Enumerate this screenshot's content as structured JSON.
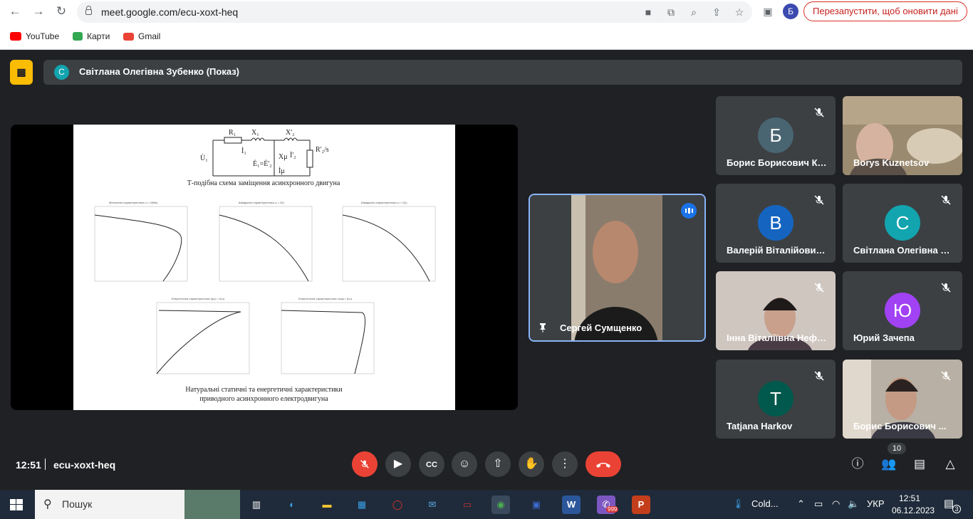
{
  "browser": {
    "url": "meet.google.com/ecu-xoxt-heq",
    "profile_initial": "Б",
    "relaunch_label": "Перезапустити, щоб оновити дані",
    "bookmarks": [
      {
        "label": "YouTube",
        "color": "#ff0000"
      },
      {
        "label": "Карти",
        "color": "#34a853"
      },
      {
        "label": "Gmail",
        "color": "#ea4335"
      }
    ]
  },
  "meet": {
    "presenter": {
      "initial": "С",
      "label": "Світлана Олегівна Зубенко (Показ)"
    },
    "slide": {
      "diagram_caption": "Т-подібна схема заміщення асинхронного двигуна",
      "bottom_caption_line1": "Натуральні статичні та енергетичні характеристики",
      "bottom_caption_line2": "приводного асинхронного електродвигуна"
    },
    "featured": {
      "name": "Сергей Сумщенко"
    },
    "participants": [
      {
        "initial": "Б",
        "name": "Борис Борисович Ко...",
        "color": "#4a6572",
        "photo": false
      },
      {
        "initial": "",
        "name": "Borys Kuznetsov",
        "color": "",
        "photo": true
      },
      {
        "initial": "В",
        "name": "Валерій Віталійович ...",
        "color": "#1565c0",
        "photo": false
      },
      {
        "initial": "С",
        "name": "Світлана Олегівна З...",
        "color": "#12a4af",
        "photo": false
      },
      {
        "initial": "",
        "name": "Інна Віталіївна Нефь...",
        "color": "",
        "photo": true
      },
      {
        "initial": "Ю",
        "name": "Юрий Зачепа",
        "color": "#a142f4",
        "photo": false
      },
      {
        "initial": "T",
        "name": "Tatjana Harkov",
        "color": "#00594c",
        "photo": false
      },
      {
        "initial": "",
        "name": "Борис Борисович ...",
        "color": "",
        "photo": true
      }
    ],
    "time": "12:51",
    "meeting_code": "ecu-xoxt-heq",
    "participant_count": "10"
  },
  "taskbar": {
    "search_placeholder": "Пошук",
    "weather": "Cold...",
    "language": "УКР",
    "time": "12:51",
    "date": "06.12.2023",
    "notifications": "3",
    "viber_badge": "999"
  }
}
